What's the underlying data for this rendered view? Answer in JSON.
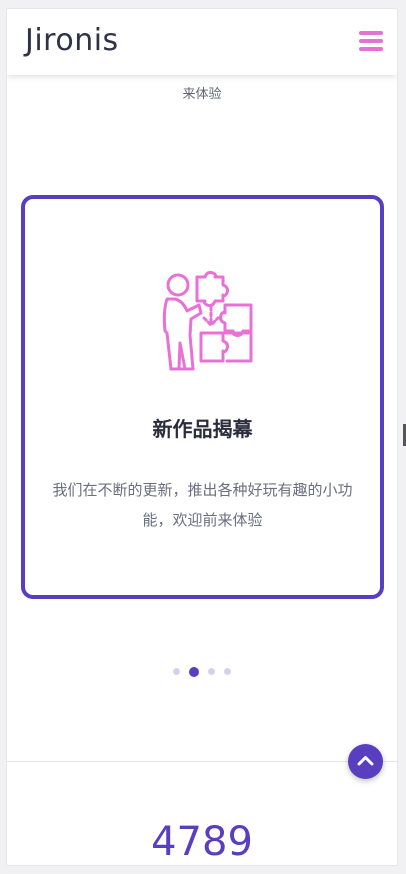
{
  "header": {
    "brand": "Jironis",
    "menu_icon": "hamburger-icon"
  },
  "carousel": {
    "previous_slide_text": "来体验",
    "slide": {
      "icon": "puzzle-person-icon",
      "title": "新作品揭幕",
      "description": "我们在不断的更新，推出各种好玩有趣的小功能，欢迎前来体验"
    },
    "dots": [
      false,
      true,
      false,
      false
    ]
  },
  "back_to_top_icon": "chevron-up-icon",
  "stats": {
    "counter": "4789"
  },
  "colors": {
    "accent": "#5a3ec0",
    "menu": "#e871d5",
    "icon": "#e871d5"
  }
}
